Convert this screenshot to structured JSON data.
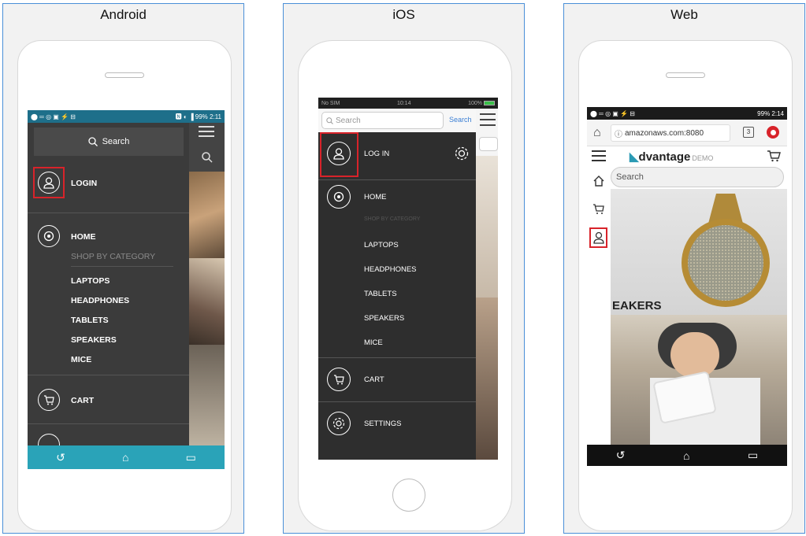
{
  "panels": {
    "android": {
      "title": "Android",
      "status": {
        "left_icons": "⬤ ═ ◎ ▣ ⚡ ⊟",
        "right": "🅽 ◐ ▐ 99%",
        "time": "2:11"
      },
      "search": "Search",
      "login": "LOGIN",
      "home": "HOME",
      "shop_by_category": "SHOP BY CATEGORY",
      "categories": [
        "LAPTOPS",
        "HEADPHONES",
        "TABLETS",
        "SPEAKERS",
        "MICE"
      ],
      "cart": "CART"
    },
    "ios": {
      "title": "iOS",
      "status": {
        "left": "No SIM",
        "center": "10:14",
        "right": "100%"
      },
      "search_placeholder": "Search",
      "search_button": "Search",
      "login": "LOG IN",
      "home": "HOME",
      "shop_by_category": "SHOP BY CATEGORY",
      "categories": [
        "LAPTOPS",
        "HEADPHONES",
        "TABLETS",
        "SPEAKERS",
        "MICE"
      ],
      "cart": "CART",
      "settings": "SETTINGS"
    },
    "web": {
      "title": "Web",
      "status": {
        "right": "99%",
        "time": "2:14"
      },
      "url": "amazonaws.com:8080",
      "tab_count": "3",
      "logo_main": "dvantage",
      "logo_demo": "DEMO",
      "search_placeholder": "Search",
      "banner_text": "EAKERS"
    }
  },
  "colors": {
    "panel_border": "#4a8fd8",
    "highlight": "#d8232a",
    "drawer": "#3b3b3b",
    "android_nav": "#2aa3b8",
    "ios_link": "#3b7fd4"
  }
}
